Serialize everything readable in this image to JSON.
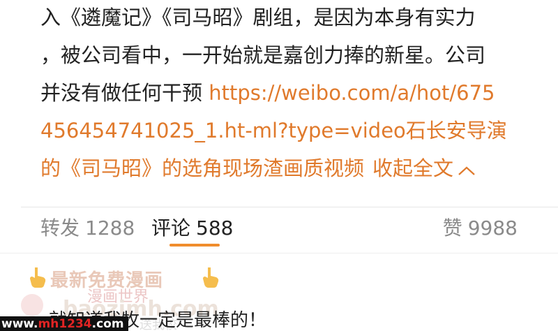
{
  "post": {
    "line1": "入《遴魔记》《司马昭》剧组，是因为本身有实力",
    "line2": "，被公司看中，一开始就是嘉创力捧的新星。公司",
    "line3_text": "并没有做任何干预 ",
    "line3_link": "https://weibo.com/a/hot/675",
    "line4_link": "456454741025_1.ht-ml?type=video石长安导演",
    "line5_link": "的《司马昭》的选角现场渣画质视频",
    "collapse_label": "收起全文"
  },
  "actions": {
    "repost_label": "转发",
    "repost_count": "1288",
    "comment_label": "评论",
    "comment_count": "588",
    "like_label": "赞",
    "like_count": "9988"
  },
  "watermark": {
    "banner": "最新免费漫画",
    "cn_text": "漫画世界",
    "domain": "baozimh.com",
    "sub_text": "送我校"
  },
  "site_badge": {
    "prefix": "www.",
    "brand": "mh1234",
    "suffix": ".com"
  },
  "comment": {
    "text": "就知道我牧一定是最棒的！"
  },
  "colors": {
    "link": "#e07a2c",
    "underline": "#f08c2c",
    "text": "#222222",
    "muted": "#8a8a8a"
  }
}
